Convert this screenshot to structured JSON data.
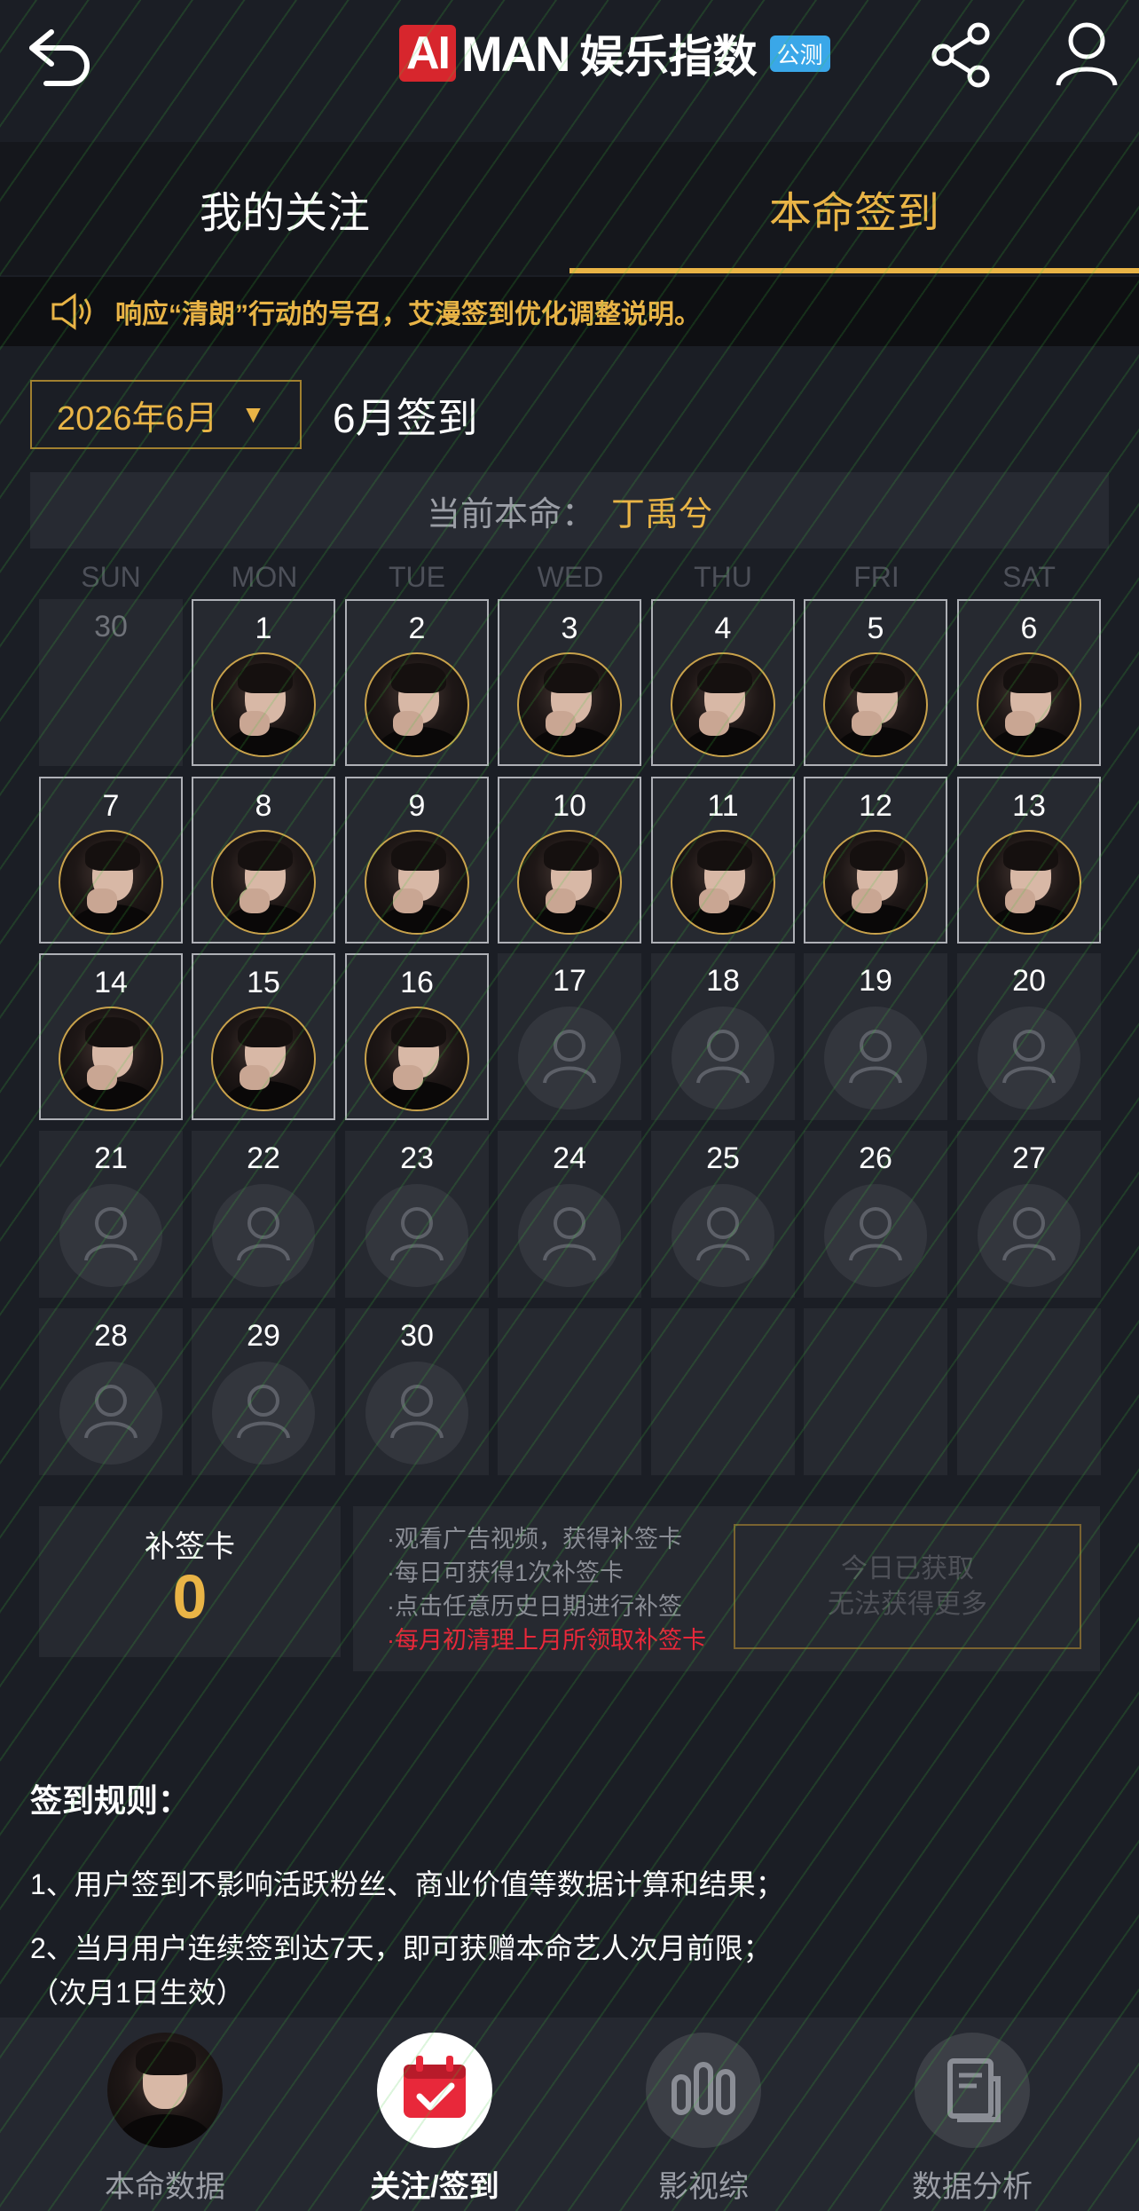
{
  "header": {
    "logo_ai": "AI",
    "logo_man": "MAN",
    "logo_cn": "娱乐指数",
    "logo_badge": "公测",
    "back_icon": "back-arrow-icon",
    "share_icon": "share-icon",
    "user_icon": "user-icon"
  },
  "tabs": [
    {
      "label": "我的关注",
      "active": false
    },
    {
      "label": "本命签到",
      "active": true
    }
  ],
  "notice": {
    "icon": "speaker-icon",
    "text": "响应“清朗”行动的号召，艾漫签到优化调整说明。"
  },
  "month_select": {
    "value": "2026年6月",
    "arrow": "▼"
  },
  "month_title": "6月签到",
  "current": {
    "label": "当前本命：",
    "name": "丁禹兮"
  },
  "weekdays": [
    "SUN",
    "MON",
    "TUE",
    "WED",
    "THU",
    "FRI",
    "SAT"
  ],
  "calendar": [
    {
      "day": "30",
      "state": "other"
    },
    {
      "day": "1",
      "state": "signed"
    },
    {
      "day": "2",
      "state": "signed"
    },
    {
      "day": "3",
      "state": "signed"
    },
    {
      "day": "4",
      "state": "signed"
    },
    {
      "day": "5",
      "state": "signed"
    },
    {
      "day": "6",
      "state": "signed"
    },
    {
      "day": "7",
      "state": "signed"
    },
    {
      "day": "8",
      "state": "signed"
    },
    {
      "day": "9",
      "state": "signed"
    },
    {
      "day": "10",
      "state": "signed"
    },
    {
      "day": "11",
      "state": "signed"
    },
    {
      "day": "12",
      "state": "signed"
    },
    {
      "day": "13",
      "state": "signed"
    },
    {
      "day": "14",
      "state": "signed"
    },
    {
      "day": "15",
      "state": "signed"
    },
    {
      "day": "16",
      "state": "signed"
    },
    {
      "day": "17",
      "state": "unsigned"
    },
    {
      "day": "18",
      "state": "unsigned"
    },
    {
      "day": "19",
      "state": "unsigned"
    },
    {
      "day": "20",
      "state": "unsigned"
    },
    {
      "day": "21",
      "state": "unsigned"
    },
    {
      "day": "22",
      "state": "unsigned"
    },
    {
      "day": "23",
      "state": "unsigned"
    },
    {
      "day": "24",
      "state": "unsigned"
    },
    {
      "day": "25",
      "state": "unsigned"
    },
    {
      "day": "26",
      "state": "unsigned"
    },
    {
      "day": "27",
      "state": "unsigned"
    },
    {
      "day": "28",
      "state": "unsigned"
    },
    {
      "day": "29",
      "state": "unsigned"
    },
    {
      "day": "30",
      "state": "unsigned"
    },
    {
      "day": "",
      "state": "empty"
    },
    {
      "day": "",
      "state": "empty"
    },
    {
      "day": "",
      "state": "empty"
    },
    {
      "day": "",
      "state": "empty"
    }
  ],
  "supplement": {
    "title": "补签卡",
    "count": "0",
    "lines": [
      "·观看广告视频，获得补签卡",
      "·每日可获得1次补签卡",
      "·点击任意历史日期进行补签"
    ],
    "red_line": "·每月初清理上月所领取补签卡",
    "button_line1": "今日已获取",
    "button_line2": "无法获得更多"
  },
  "rules": {
    "title": "签到规则：",
    "items": [
      "1、用户签到不影响活跃粉丝、商业价值等数据计算和结果；",
      "2、当月用户连续签到达7天，即可获赠本命艺人次月前限；（次月1日生效）"
    ]
  },
  "bottom_nav": [
    {
      "label": "本命数据",
      "icon": "avatar-icon",
      "active": false
    },
    {
      "label": "关注/签到",
      "icon": "calendar-check-icon",
      "active": true
    },
    {
      "label": "影视综",
      "icon": "film-bars-icon",
      "active": false
    },
    {
      "label": "数据分析",
      "icon": "document-icon",
      "active": false
    }
  ],
  "colors": {
    "accent": "#e9b446",
    "background": "#1b1e25",
    "cell": "#262930",
    "red": "#e8283a"
  }
}
